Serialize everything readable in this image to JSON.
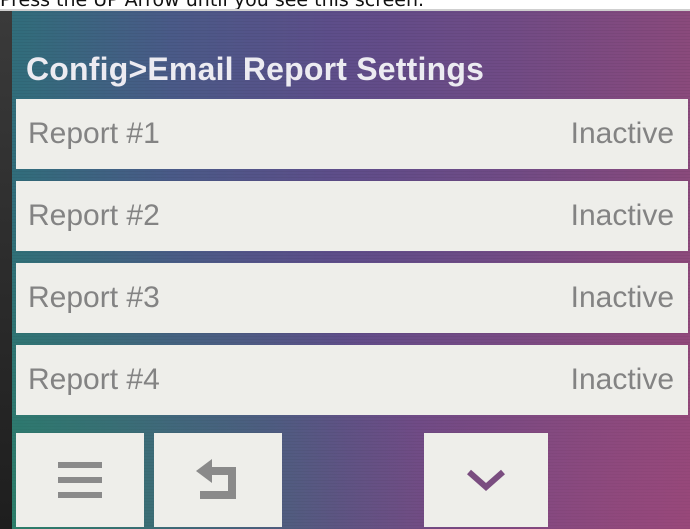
{
  "caption": "Press the UP Arrow until you see this screen.",
  "header": {
    "title": "Config>Email Report Settings"
  },
  "reports": [
    {
      "label": "Report #1",
      "status": "Inactive"
    },
    {
      "label": "Report #2",
      "status": "Inactive"
    },
    {
      "label": "Report #3",
      "status": "Inactive"
    },
    {
      "label": "Report #4",
      "status": "Inactive"
    }
  ],
  "toolbar": {
    "menu_icon": "hamburger-menu-icon",
    "back_icon": "return-arrow-icon",
    "down_icon": "chevron-down-icon"
  },
  "colors": {
    "row_background": "#eeeeea",
    "row_text": "#838383",
    "title_text": "#ecebf1",
    "icon": "#8a8a8a"
  }
}
